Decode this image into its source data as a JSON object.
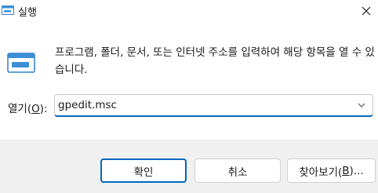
{
  "window": {
    "title": "실행",
    "close_glyph": "✕"
  },
  "content": {
    "description": "프로그램, 폴더, 문서, 또는 인터넷 주소를 입력하여 해당 항목을 열 수 있습니다.",
    "open_label_prefix": "열기(",
    "open_label_key": "O",
    "open_label_suffix": "):",
    "input_value": "gpedit.msc"
  },
  "buttons": {
    "ok": "확인",
    "cancel": "취소",
    "browse_prefix": "찾아보기(",
    "browse_key": "B",
    "browse_suffix": ")..."
  },
  "colors": {
    "accent": "#0067c0",
    "icon_blue": "#3b8fd6"
  },
  "icons": {
    "title": "run-window-icon",
    "main": "run-window-icon",
    "close": "close-icon",
    "dropdown": "chevron-down-icon"
  }
}
